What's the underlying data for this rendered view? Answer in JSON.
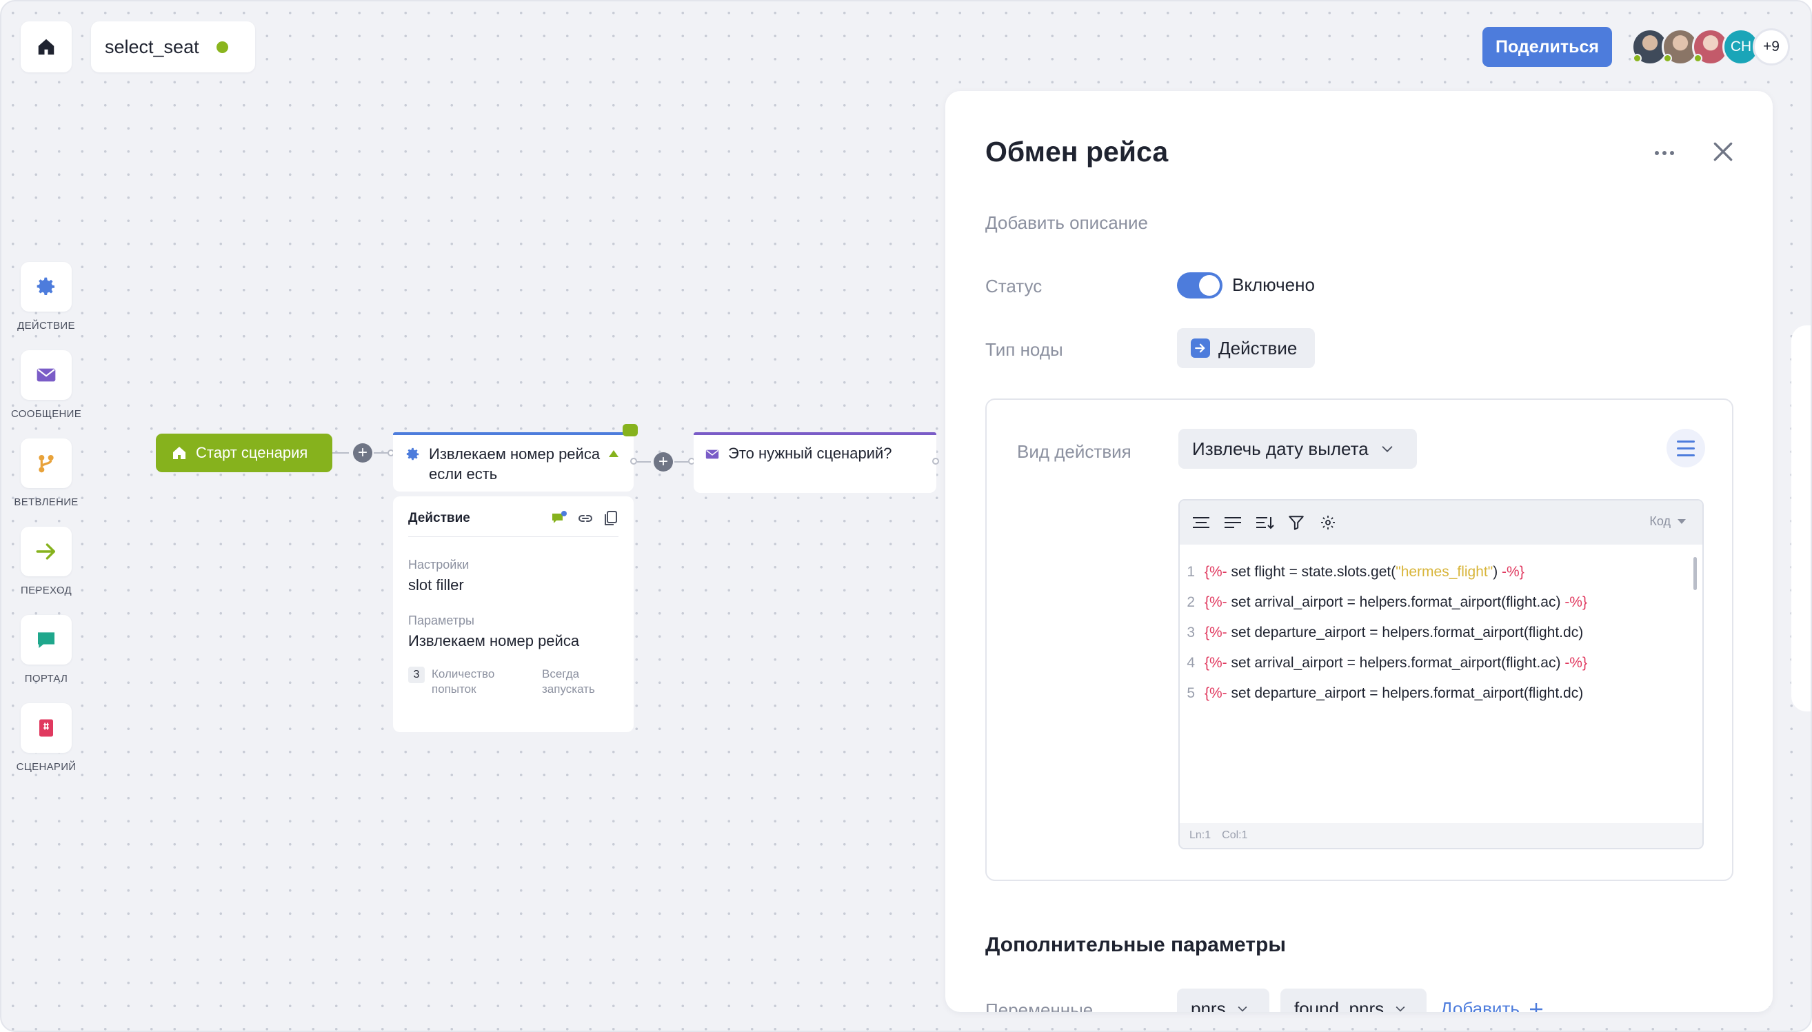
{
  "header": {
    "scenario_name": "select_seat",
    "share_label": "Поделиться",
    "collaborators": [
      {
        "kind": "photo",
        "color": "#3f4a5a"
      },
      {
        "kind": "photo",
        "color": "#8a7566"
      },
      {
        "kind": "photo",
        "color": "#c79a8f"
      },
      {
        "kind": "initials",
        "initials": "CH",
        "color": "#1aa5b8"
      }
    ],
    "collaborators_more": "+9"
  },
  "palette": {
    "items": [
      {
        "label": "ДЕЙСТВИЕ",
        "icon": "gear-icon",
        "color": "#4d7cdc"
      },
      {
        "label": "СООБЩЕНИЕ",
        "icon": "envelope-icon",
        "color": "#7a5cc7"
      },
      {
        "label": "ВЕТВЛЕНИЕ",
        "icon": "branch-icon",
        "color": "#e8a23a"
      },
      {
        "label": "ПЕРЕХОД",
        "icon": "arrow-right-icon",
        "color": "#86b21d"
      },
      {
        "label": "ПОРТАЛ",
        "icon": "chat-bubble-icon",
        "color": "#1fa78c"
      },
      {
        "label": "СЦЕНАРИЙ",
        "icon": "scenario-book-icon",
        "color": "#e0395f"
      }
    ]
  },
  "flow": {
    "start_node": "Старт сценария",
    "extract_node": {
      "title_line1": "Извлекаем номер рейса",
      "title_line2": "если есть"
    },
    "extract_detail": {
      "header": "Действие",
      "settings_label": "Настройки",
      "settings_value": "slot filler",
      "params_label": "Параметры",
      "params_value": "Извлекаем номер рейса",
      "attempts_count": "3",
      "attempts_label_line1": "Количество",
      "attempts_label_line2": "попыток",
      "always_label_line1": "Всегда",
      "always_label_line2": "запускать"
    },
    "question_node": "Это нужный сценарий?"
  },
  "panel": {
    "title": "Обмен рейса",
    "description_placeholder": "Добавить описание",
    "status_label": "Статус",
    "status_value": "Включено",
    "node_type_label": "Тип ноды",
    "node_type_value": "Действие",
    "action_kind_label": "Вид действия",
    "action_kind_value": "Извлечь дату вылета",
    "editor": {
      "language": "Код",
      "lines": [
        {
          "n": "1",
          "open": "{%-",
          "body": " set flight = state.slots.get(",
          "str": "\"hermes_flight\"",
          "body2": ") ",
          "close": "-%}"
        },
        {
          "n": "2",
          "open": "{%-",
          "body": " set arrival_airport = helpers.format_airport(flight.ac) ",
          "str": "",
          "body2": "",
          "close": "-%}"
        },
        {
          "n": "3",
          "open": "{%-",
          "body": " set departure_airport = helpers.format_airport(flight.dc)",
          "str": "",
          "body2": "",
          "close": ""
        },
        {
          "n": "4",
          "open": "{%-",
          "body": " set arrival_airport = helpers.format_airport(flight.ac) ",
          "str": "",
          "body2": "",
          "close": "-%}"
        },
        {
          "n": "5",
          "open": "{%-",
          "body": " set departure_airport = helpers.format_airport(flight.dc)",
          "str": "",
          "body2": "",
          "close": ""
        }
      ],
      "status_ln": "Ln:1",
      "status_col": "Col:1"
    },
    "extra_title": "Дополнительные параметры",
    "variables_label": "Переменные",
    "variables": [
      "pnrs",
      "found_pnrs"
    ],
    "add_label": "Добавить"
  },
  "colors": {
    "accent": "#4d7cdc",
    "start_green": "#86b21d",
    "message_purple": "#7a5cc7",
    "code_tag": "#e0395f",
    "code_string": "#d8b53a"
  }
}
